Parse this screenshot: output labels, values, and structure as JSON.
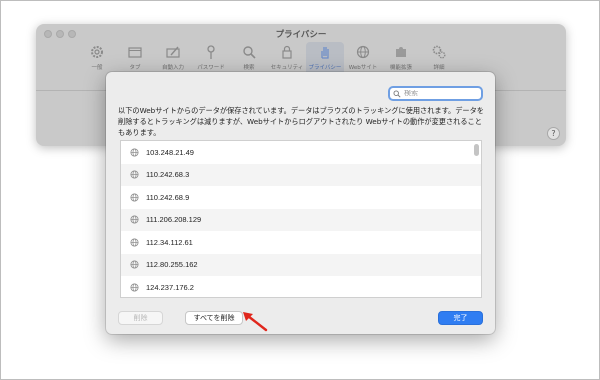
{
  "prefs": {
    "title": "プライバシー",
    "help_label": "?",
    "toolbar": [
      {
        "label": "一般",
        "icon": "gear-icon"
      },
      {
        "label": "タブ",
        "icon": "tabs-icon"
      },
      {
        "label": "自動入力",
        "icon": "pencil-box-icon"
      },
      {
        "label": "パスワード",
        "icon": "key-icon"
      },
      {
        "label": "検索",
        "icon": "magnifier-icon"
      },
      {
        "label": "セキュリティ",
        "icon": "lock-icon"
      },
      {
        "label": "プライバシー",
        "icon": "hand-icon",
        "active": true
      },
      {
        "label": "Webサイト",
        "icon": "globe-icon"
      },
      {
        "label": "機能拡張",
        "icon": "puzzle-icon"
      },
      {
        "label": "詳細",
        "icon": "gears-icon"
      }
    ]
  },
  "sheet": {
    "search": {
      "placeholder": "検索",
      "value": ""
    },
    "description": "以下のWebサイトからのデータが保存されています。データはブラウズのトラッキングに使用されます。データを削除するとトラッキングは減りますが、Webサイトからログアウトされたり Webサイトの動作が変更されることもあります。",
    "sites": [
      "103.248.21.49",
      "110.242.68.3",
      "110.242.68.9",
      "111.206.208.129",
      "112.34.112.61",
      "112.80.255.162",
      "124.237.176.2"
    ],
    "buttons": {
      "delete": "削除",
      "delete_all": "すべてを削除",
      "done": "完了"
    }
  },
  "colors": {
    "accent": "#2f7df2",
    "annotation_arrow": "#e0261c"
  }
}
